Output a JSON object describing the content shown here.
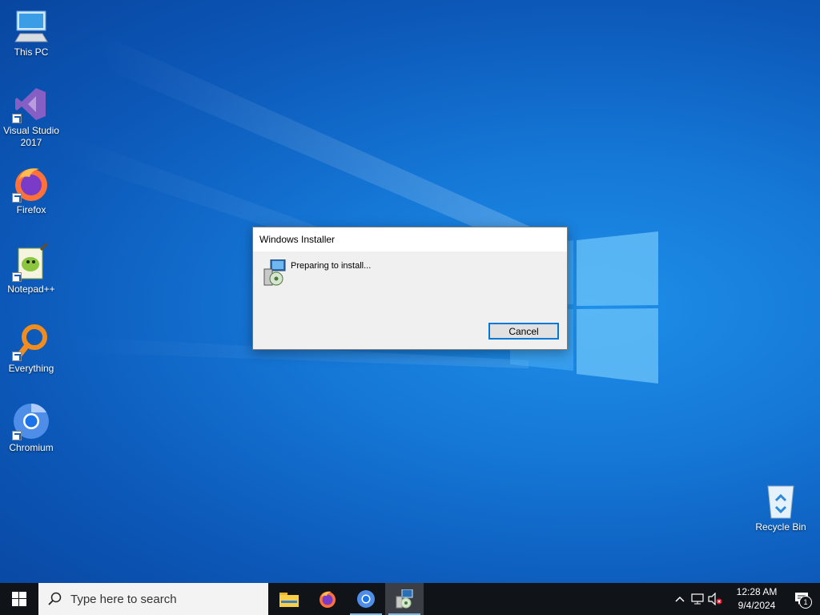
{
  "desktop": {
    "icons": [
      {
        "label": "This PC"
      },
      {
        "label": "Visual Studio 2017"
      },
      {
        "label": "Firefox"
      },
      {
        "label": "Notepad++"
      },
      {
        "label": "Everything"
      },
      {
        "label": "Chromium"
      },
      {
        "label": "Recycle Bin"
      }
    ]
  },
  "dialog": {
    "title": "Windows Installer",
    "message": "Preparing to install...",
    "cancel_label": "Cancel",
    "icon": "installer-icon"
  },
  "taskbar": {
    "search_placeholder": "Type here to search",
    "apps": [
      "file-explorer-icon",
      "firefox-icon",
      "chromium-icon",
      "windows-installer-icon"
    ],
    "active_app": "windows-installer-icon",
    "tray": {
      "time": "12:28 AM",
      "date": "9/4/2024",
      "notification_count": "1"
    }
  },
  "colors": {
    "desktop_bg": "#1577d6",
    "taskbar_bg": "#101418",
    "accent": "#0078d7"
  }
}
